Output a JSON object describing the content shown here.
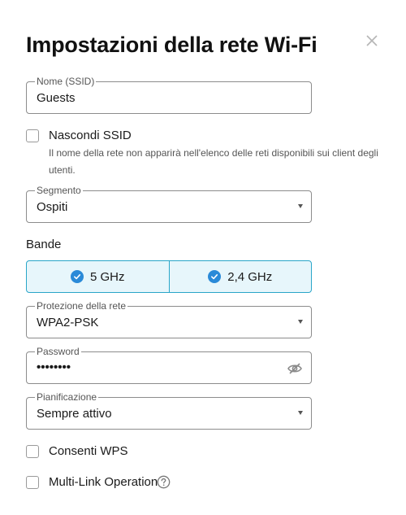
{
  "dialog": {
    "title": "Impostazioni della rete Wi-Fi",
    "close_icon": "close-icon"
  },
  "ssid": {
    "legend": "Nome (SSID)",
    "value": "Guests"
  },
  "hide_ssid": {
    "label": "Nascondi SSID",
    "checked": false,
    "hint": "Il nome della rete non apparirà nell'elenco delle reti disponibili sui client degli utenti."
  },
  "segment": {
    "legend": "Segmento",
    "value": "Ospiti"
  },
  "bands": {
    "label": "Bande",
    "options": [
      {
        "label": "5 GHz",
        "selected": true
      },
      {
        "label": "2,4 GHz",
        "selected": true
      }
    ],
    "accent": "#2aa6c9",
    "check_color": "#2a8ad8"
  },
  "security": {
    "legend": "Protezione della rete",
    "value": "WPA2-PSK"
  },
  "password": {
    "legend": "Password",
    "value": "••••••••",
    "visibility_icon": "eye-off-icon"
  },
  "schedule": {
    "legend": "Pianificazione",
    "value": "Sempre attivo"
  },
  "wps": {
    "label": "Consenti WPS",
    "checked": false
  },
  "mlo": {
    "label": "Multi-Link Operation",
    "checked": false,
    "help_icon": "help-icon"
  }
}
